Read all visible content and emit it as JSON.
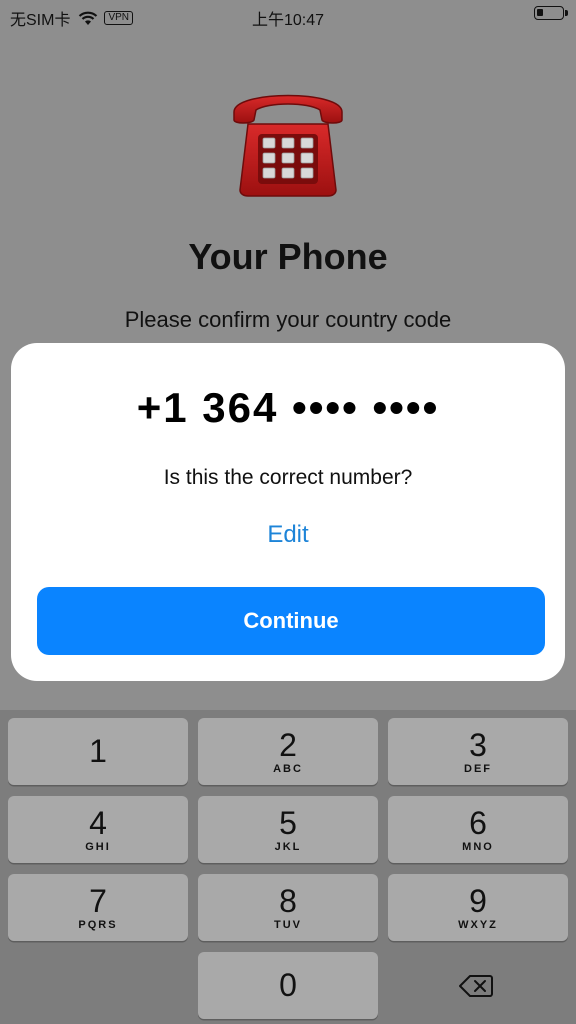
{
  "status_bar": {
    "carrier": "无SIM卡",
    "vpn": "VPN",
    "time": "上午10:47",
    "battery_level": 0.25
  },
  "page": {
    "title": "Your Phone",
    "subtitle": "Please confirm your country code",
    "icon": "red-telephone-emoji"
  },
  "dialog": {
    "phone_number": "+1 364 •••• ••••",
    "question": "Is this the correct number?",
    "edit_label": "Edit",
    "continue_label": "Continue",
    "accent_color": "#0a84ff"
  },
  "keypad": {
    "keys": [
      {
        "digit": "1",
        "letters": ""
      },
      {
        "digit": "2",
        "letters": "ABC"
      },
      {
        "digit": "3",
        "letters": "DEF"
      },
      {
        "digit": "4",
        "letters": "GHI"
      },
      {
        "digit": "5",
        "letters": "JKL"
      },
      {
        "digit": "6",
        "letters": "MNO"
      },
      {
        "digit": "7",
        "letters": "PQRS"
      },
      {
        "digit": "8",
        "letters": "TUV"
      },
      {
        "digit": "9",
        "letters": "WXYZ"
      },
      {
        "digit": "0",
        "letters": ""
      }
    ],
    "backspace_icon": "backspace-icon"
  }
}
